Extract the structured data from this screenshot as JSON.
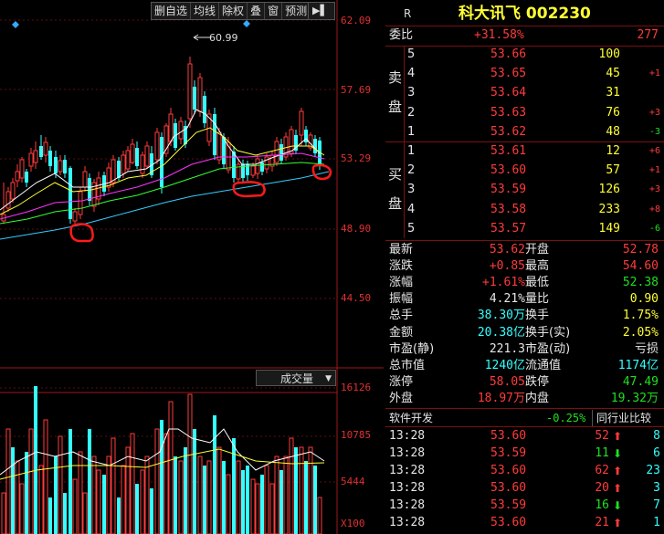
{
  "toolbar": {
    "items": [
      "删自选",
      "均线",
      "除权",
      "叠",
      "窗",
      "预测"
    ],
    "menu_icon": "arrow-menu-icon"
  },
  "price_axis": [
    "62.09",
    "57.69",
    "53.29",
    "48.90",
    "44.50"
  ],
  "volume_axis": [
    "16126",
    "10785",
    "5444",
    "X100"
  ],
  "high_marker": "60.99",
  "volume_menu": "成交量",
  "header": {
    "badge": "R",
    "title": "科大讯飞 002230"
  },
  "weibi": {
    "label": "委比",
    "pct": "+31.58%",
    "value": "277"
  },
  "sell_side": {
    "label_top": "卖",
    "label_bottom": "盘",
    "rows": [
      {
        "level": "5",
        "price": "53.66",
        "vol": "100",
        "chg": ""
      },
      {
        "level": "4",
        "price": "53.65",
        "vol": "45",
        "chg": "+1"
      },
      {
        "level": "3",
        "price": "53.64",
        "vol": "31",
        "chg": ""
      },
      {
        "level": "2",
        "price": "53.63",
        "vol": "76",
        "chg": "+3"
      },
      {
        "level": "1",
        "price": "53.62",
        "vol": "48",
        "chg": "-3"
      }
    ]
  },
  "buy_side": {
    "label_top": "买",
    "label_bottom": "盘",
    "rows": [
      {
        "level": "1",
        "price": "53.61",
        "vol": "12",
        "chg": "+6"
      },
      {
        "level": "2",
        "price": "53.60",
        "vol": "57",
        "chg": "+1"
      },
      {
        "level": "3",
        "price": "53.59",
        "vol": "126",
        "chg": "+3"
      },
      {
        "level": "4",
        "price": "53.58",
        "vol": "233",
        "chg": "+8"
      },
      {
        "level": "5",
        "price": "53.57",
        "vol": "149",
        "chg": "-6"
      }
    ]
  },
  "stats": [
    {
      "l1": "最新",
      "v1": "53.62",
      "c1": "red",
      "l2": "开盘",
      "v2": "52.78",
      "c2": "red"
    },
    {
      "l1": "涨跌",
      "v1": "+0.85",
      "c1": "red",
      "l2": "最高",
      "v2": "54.60",
      "c2": "red"
    },
    {
      "l1": "涨幅",
      "v1": "+1.61%",
      "c1": "red",
      "l2": "最低",
      "v2": "52.38",
      "c2": "grn"
    },
    {
      "l1": "振幅",
      "v1": "4.21%",
      "c1": "wht",
      "l2": "量比",
      "v2": "0.90",
      "c2": "yel"
    },
    {
      "l1": "总手",
      "v1": "38.30万",
      "c1": "cyan",
      "l2": "换手",
      "v2": "1.75%",
      "c2": "yel"
    },
    {
      "l1": "金额",
      "v1": "20.38亿",
      "c1": "cyan",
      "l2": "换手(实)",
      "v2": "2.05%",
      "c2": "yel"
    },
    {
      "l1": "市盈(静)",
      "v1": "221.3",
      "c1": "wht",
      "l2": "市盈(动)",
      "v2": "亏损",
      "c2": "wht"
    },
    {
      "l1": "总市值",
      "v1": "1240亿",
      "c1": "cyan",
      "l2": "流通值",
      "v2": "1174亿",
      "c2": "cyan"
    },
    {
      "l1": "涨停",
      "v1": "58.05",
      "c1": "red",
      "l2": "跌停",
      "v2": "47.49",
      "c2": "grn"
    },
    {
      "l1": "外盘",
      "v1": "18.97万",
      "c1": "red",
      "l2": "内盘",
      "v2": "19.32万",
      "c2": "grn"
    }
  ],
  "sector": {
    "name": "软件开发",
    "pct": "-0.25%",
    "compare": "同行业比较"
  },
  "ticks": [
    {
      "time": "13:28",
      "price": "53.60",
      "vol": "52",
      "dir": "up",
      "n": "8"
    },
    {
      "time": "13:28",
      "price": "53.59",
      "vol": "11",
      "dir": "down",
      "n": "6"
    },
    {
      "time": "13:28",
      "price": "53.60",
      "vol": "62",
      "dir": "up",
      "n": "23"
    },
    {
      "time": "13:28",
      "price": "53.60",
      "vol": "20",
      "dir": "up",
      "n": "3"
    },
    {
      "time": "13:28",
      "price": "53.59",
      "vol": "16",
      "dir": "down",
      "n": "7"
    },
    {
      "time": "13:28",
      "price": "53.60",
      "vol": "21",
      "dir": "up",
      "n": "1"
    }
  ]
}
